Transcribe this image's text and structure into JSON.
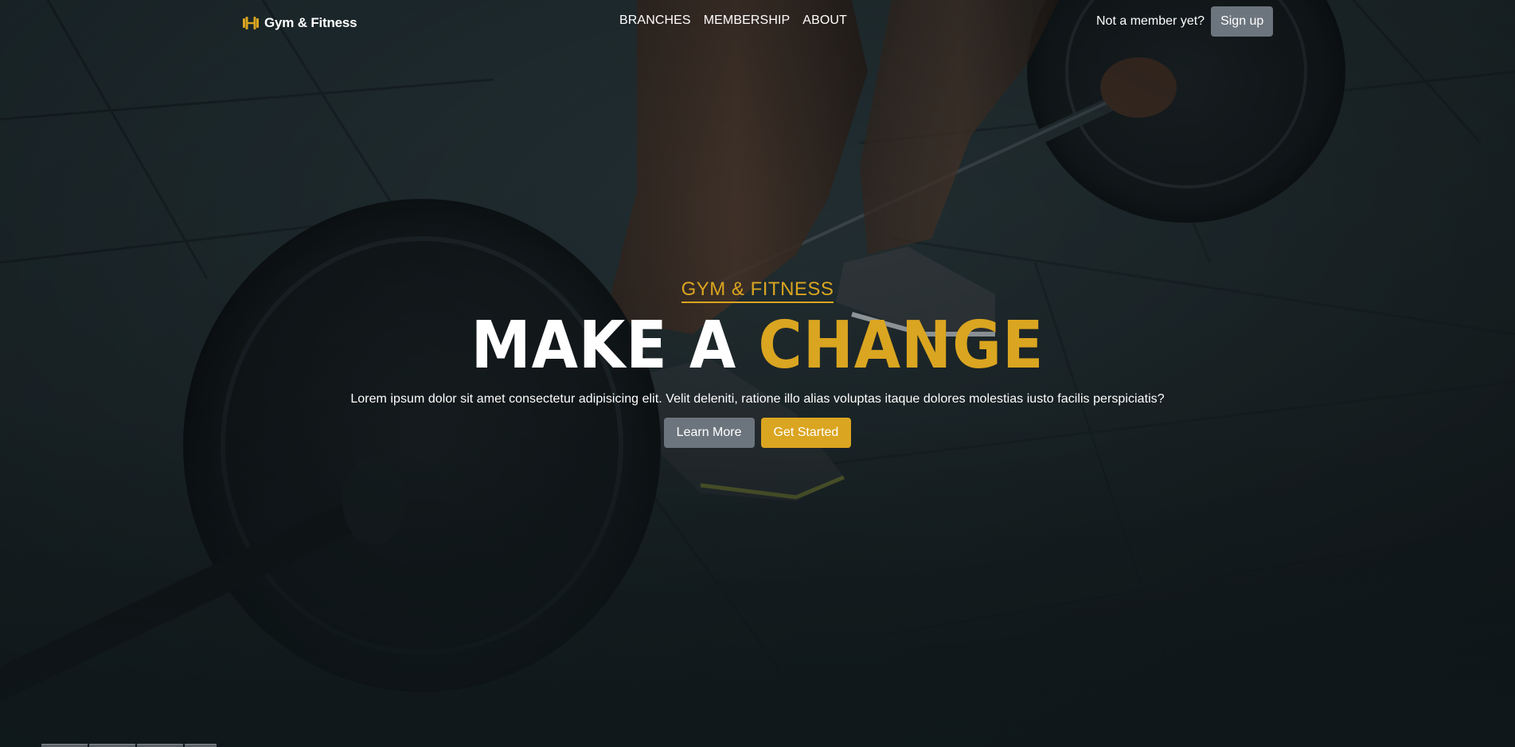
{
  "brand": {
    "name": "Gym & Fitness",
    "icon": "dumbbell-icon",
    "accent": "#daa520"
  },
  "nav": {
    "links": [
      "BRANCHES",
      "MEMBERSHIP",
      "ABOUT"
    ],
    "member_note": "Not a member yet?",
    "signup_label": "Sign up"
  },
  "hero": {
    "eyebrow": "GYM & FITNESS",
    "headline_part1": "MAKE A",
    "headline_part2": "CHANGE",
    "lead": "Lorem ipsum dolor sit amet consectetur adipisicing elit. Velit deleniti, ratione illo alias voluptas itaque dolores molestias iusto facilis perspiciatis?",
    "learn_more_label": "Learn More",
    "get_started_label": "Get Started"
  },
  "colors": {
    "gold": "#daa520",
    "grey_button": "#6c757d",
    "white": "#ffffff"
  }
}
